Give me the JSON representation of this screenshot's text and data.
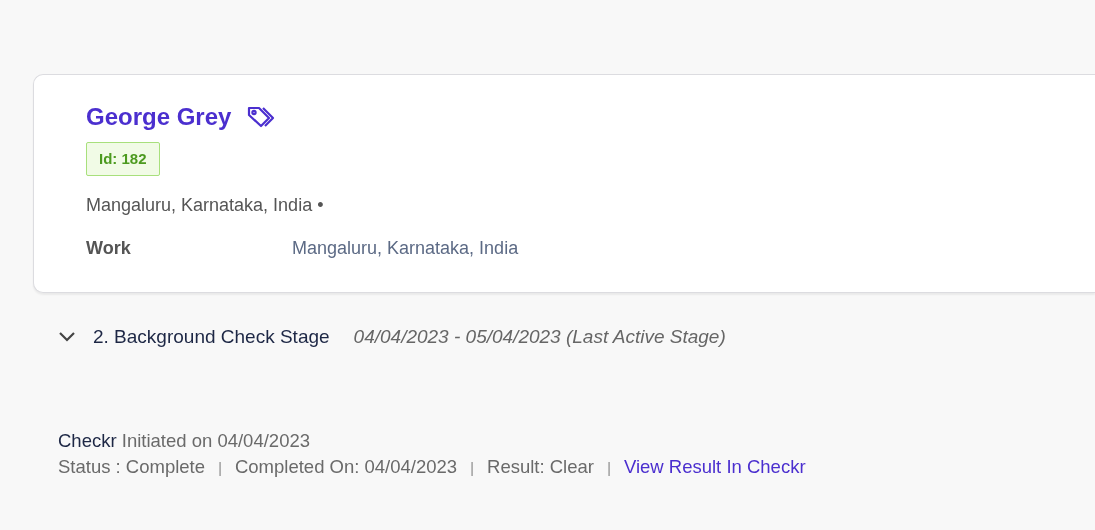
{
  "candidate": {
    "name": "George Grey",
    "id_badge": "Id: 182",
    "location": "Mangaluru, Karnataka, India",
    "location_dot": "•",
    "fields": [
      {
        "label": "Work",
        "value": "Mangaluru, Karnataka, India"
      }
    ]
  },
  "stage": {
    "title": "2. Background Check Stage",
    "dates": "04/04/2023 - 05/04/2023 (Last Active Stage)",
    "expanded": true
  },
  "check": {
    "provider": "Checkr",
    "initiated": "Initiated on 04/04/2023",
    "details": [
      {
        "kind": "text",
        "text": "Status : Complete"
      },
      {
        "kind": "separator",
        "text": "|"
      },
      {
        "kind": "text",
        "text": "Completed On: 04/04/2023"
      },
      {
        "kind": "separator",
        "text": "|"
      },
      {
        "kind": "text",
        "text": "Result: Clear"
      },
      {
        "kind": "separator",
        "text": "|"
      },
      {
        "kind": "link",
        "text": "View Result In Checkr"
      }
    ]
  }
}
